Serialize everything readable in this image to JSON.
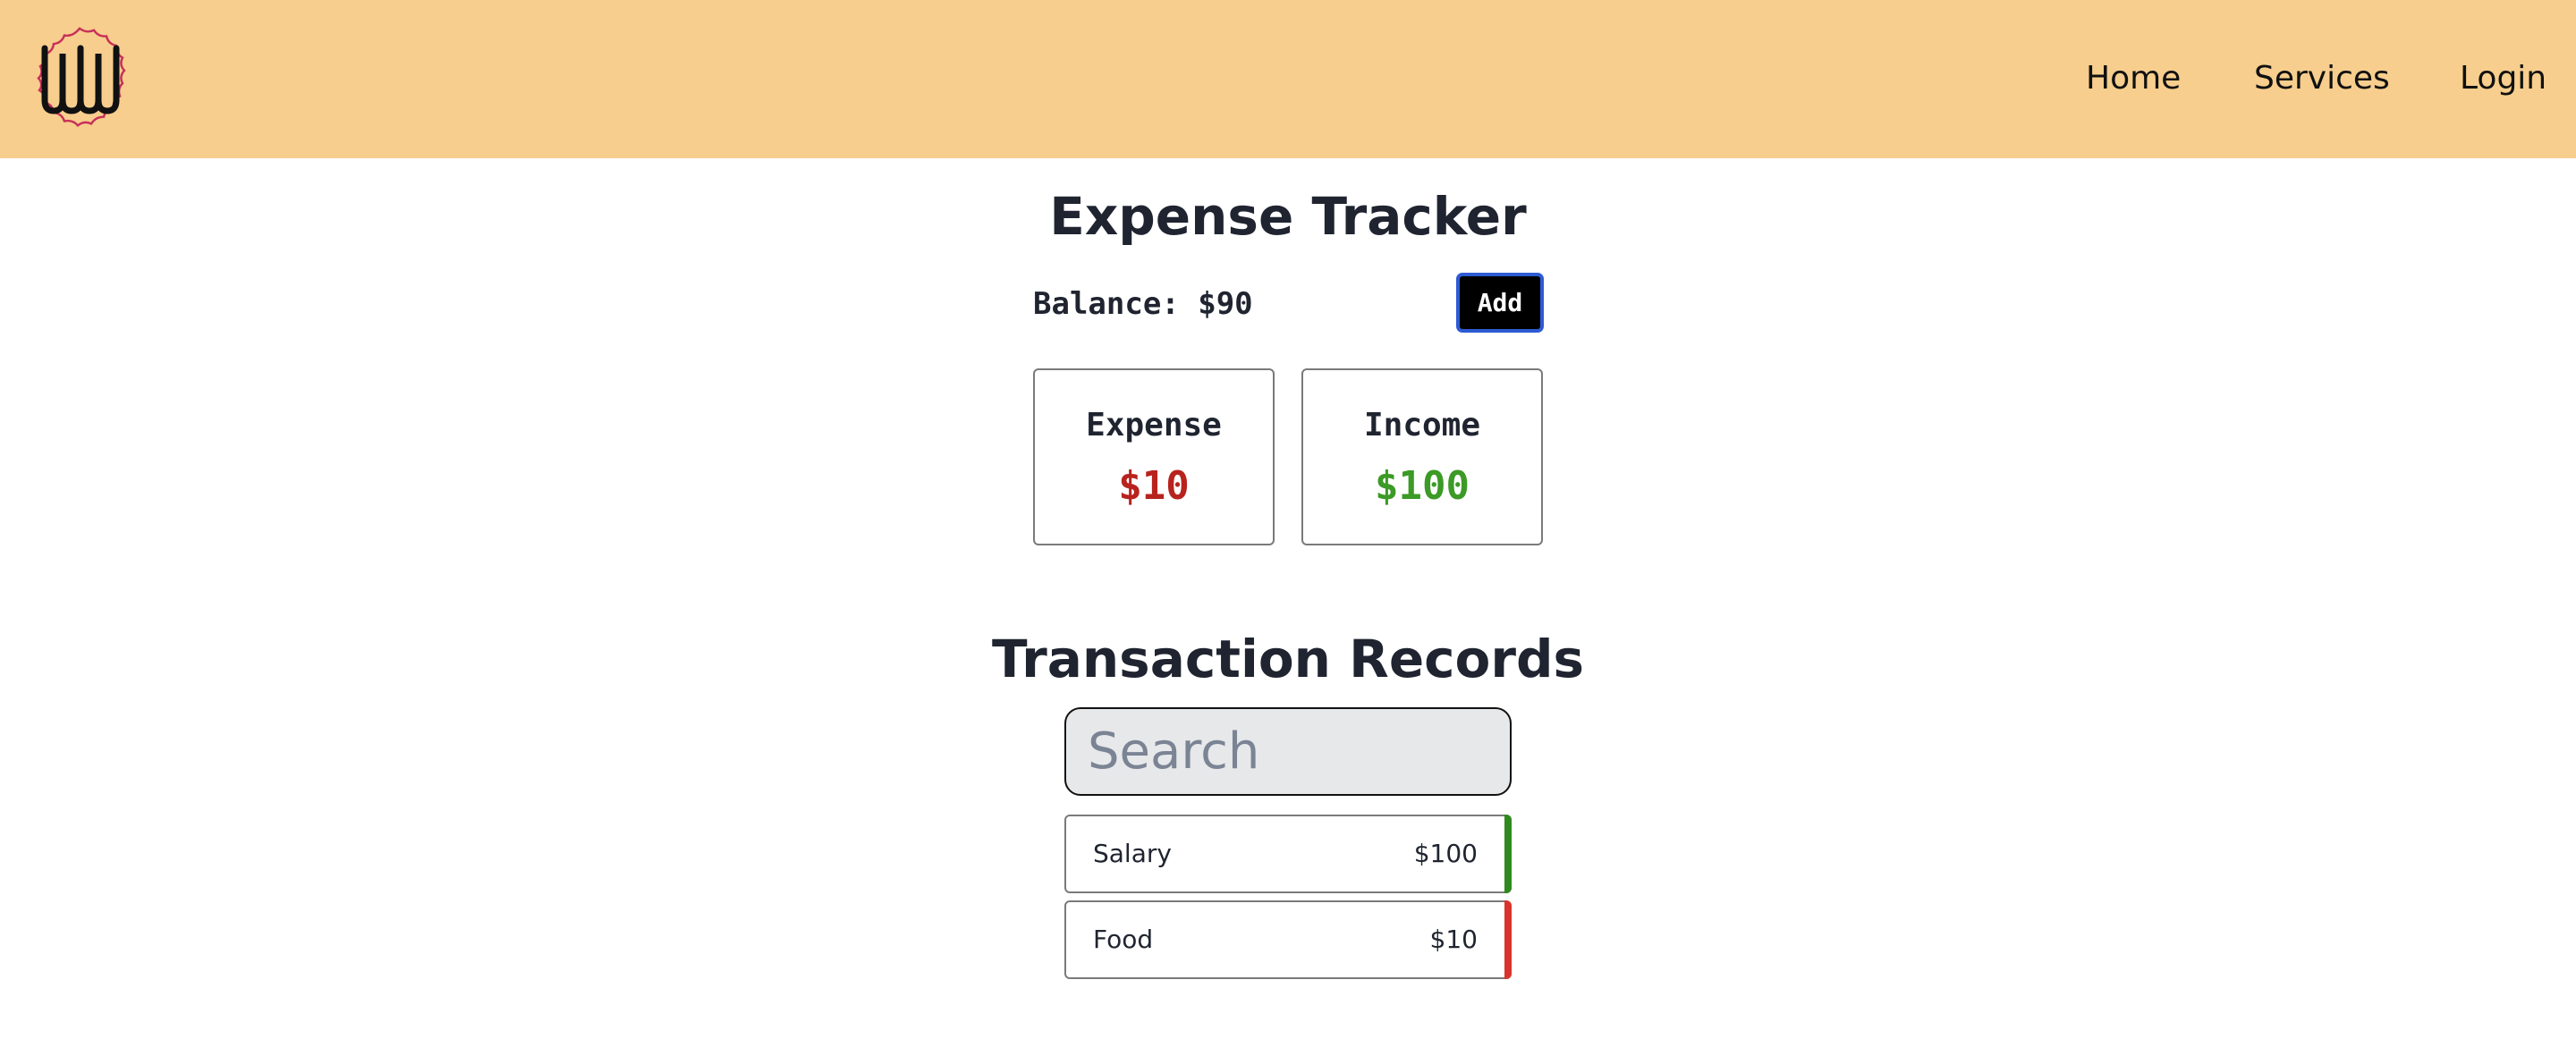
{
  "header": {
    "logo_text": "WW",
    "nav": {
      "home": "Home",
      "services": "Services",
      "login": "Login"
    }
  },
  "tracker": {
    "title": "Expense Tracker",
    "balance_label": "Balance: $90",
    "add_label": "Add",
    "expense": {
      "label": "Expense",
      "value": "$10"
    },
    "income": {
      "label": "Income",
      "value": "$100"
    }
  },
  "records": {
    "title": "Transaction Records",
    "search_placeholder": "Search",
    "items": [
      {
        "name": "Salary",
        "amount": "$100",
        "type": "income"
      },
      {
        "name": "Food",
        "amount": "$10",
        "type": "expense"
      }
    ]
  },
  "colors": {
    "header_bg": "#f7ce8d",
    "expense": "#b8231e",
    "income": "#3c9a26",
    "income_stripe": "#2f8a1e",
    "expense_stripe": "#d9342b",
    "add_button_border": "#2d5bd3",
    "logo_ring": "#c8305a"
  }
}
